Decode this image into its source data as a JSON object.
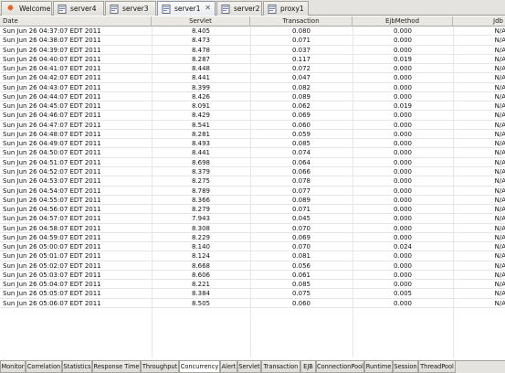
{
  "tabs": [
    {
      "label": "Welcome",
      "icon": "sun-icon",
      "active": false
    },
    {
      "label": "server4",
      "icon": "server-page-icon",
      "active": false
    },
    {
      "label": "server3",
      "icon": "server-page-icon",
      "active": false
    },
    {
      "label": "server1",
      "icon": "server-page-icon",
      "active": true,
      "close": "✕"
    },
    {
      "label": "server2",
      "icon": "server-page-icon",
      "active": false
    },
    {
      "label": "proxy1",
      "icon": "server-page-icon",
      "active": false
    }
  ],
  "table": {
    "headers": [
      "Date",
      "Servlet",
      "Transaction",
      "EjbMethod",
      "Jdb"
    ],
    "rows": [
      [
        "Sun Jun 26 04:37:07 EDT 2011",
        "8.405",
        "0.080",
        "0.000",
        "N/A"
      ],
      [
        "Sun Jun 26 04:38:07 EDT 2011",
        "8.473",
        "0.071",
        "0.000",
        "N/A"
      ],
      [
        "Sun Jun 26 04:39:07 EDT 2011",
        "8.478",
        "0.037",
        "0.000",
        "N/A"
      ],
      [
        "Sun Jun 26 04:40:07 EDT 2011",
        "8.287",
        "0.117",
        "0.019",
        "N/A"
      ],
      [
        "Sun Jun 26 04:41:07 EDT 2011",
        "8.448",
        "0.072",
        "0.000",
        "N/A"
      ],
      [
        "Sun Jun 26 04:42:07 EDT 2011",
        "8.441",
        "0.047",
        "0.000",
        "N/A"
      ],
      [
        "Sun Jun 26 04:43:07 EDT 2011",
        "8.399",
        "0.082",
        "0.000",
        "N/A"
      ],
      [
        "Sun Jun 26 04:44:07 EDT 2011",
        "8.426",
        "0.089",
        "0.000",
        "N/A"
      ],
      [
        "Sun Jun 26 04:45:07 EDT 2011",
        "8.091",
        "0.062",
        "0.019",
        "N/A"
      ],
      [
        "Sun Jun 26 04:46:07 EDT 2011",
        "8.429",
        "0.069",
        "0.000",
        "N/A"
      ],
      [
        "Sun Jun 26 04:47:07 EDT 2011",
        "8.541",
        "0.060",
        "0.000",
        "N/A"
      ],
      [
        "Sun Jun 26 04:48:07 EDT 2011",
        "8.281",
        "0.059",
        "0.000",
        "N/A"
      ],
      [
        "Sun Jun 26 04:49:07 EDT 2011",
        "8.493",
        "0.085",
        "0.000",
        "N/A"
      ],
      [
        "Sun Jun 26 04:50:07 EDT 2011",
        "8.441",
        "0.074",
        "0.000",
        "N/A"
      ],
      [
        "Sun Jun 26 04:51:07 EDT 2011",
        "8.698",
        "0.064",
        "0.000",
        "N/A"
      ],
      [
        "Sun Jun 26 04:52:07 EDT 2011",
        "8.379",
        "0.066",
        "0.000",
        "N/A"
      ],
      [
        "Sun Jun 26 04:53:07 EDT 2011",
        "8.275",
        "0.078",
        "0.000",
        "N/A"
      ],
      [
        "Sun Jun 26 04:54:07 EDT 2011",
        "8.789",
        "0.077",
        "0.000",
        "N/A"
      ],
      [
        "Sun Jun 26 04:55:07 EDT 2011",
        "8.366",
        "0.089",
        "0.000",
        "N/A"
      ],
      [
        "Sun Jun 26 04:56:07 EDT 2011",
        "8.279",
        "0.071",
        "0.000",
        "N/A"
      ],
      [
        "Sun Jun 26 04:57:07 EDT 2011",
        "7.943",
        "0.045",
        "0.000",
        "N/A"
      ],
      [
        "Sun Jun 26 04:58:07 EDT 2011",
        "8.308",
        "0.070",
        "0.000",
        "N/A"
      ],
      [
        "Sun Jun 26 04:59:07 EDT 2011",
        "8.229",
        "0.069",
        "0.000",
        "N/A"
      ],
      [
        "Sun Jun 26 05:00:07 EDT 2011",
        "8.140",
        "0.070",
        "0.024",
        "N/A"
      ],
      [
        "Sun Jun 26 05:01:07 EDT 2011",
        "8.124",
        "0.081",
        "0.000",
        "N/A"
      ],
      [
        "Sun Jun 26 05:02:07 EDT 2011",
        "8.668",
        "0.056",
        "0.000",
        "N/A"
      ],
      [
        "Sun Jun 26 05:03:07 EDT 2011",
        "8.606",
        "0.061",
        "0.000",
        "N/A"
      ],
      [
        "Sun Jun 26 05:04:07 EDT 2011",
        "8.221",
        "0.085",
        "0.000",
        "N/A"
      ],
      [
        "Sun Jun 26 05:05:07 EDT 2011",
        "8.384",
        "0.075",
        "0.005",
        "N/A"
      ],
      [
        "Sun Jun 26 05:06:07 EDT 2011",
        "8.505",
        "0.060",
        "0.000",
        "N/A"
      ]
    ]
  },
  "bottom_tabs": [
    {
      "label": "Monitor",
      "active": false
    },
    {
      "label": "Correlation",
      "active": false
    },
    {
      "label": "Statistics",
      "active": false
    },
    {
      "label": "Response Time",
      "active": false
    },
    {
      "label": "Throughput",
      "active": false
    },
    {
      "label": "Concurrency",
      "active": true
    },
    {
      "label": "Alert",
      "active": false
    },
    {
      "label": "Servlet",
      "active": false
    },
    {
      "label": "Transaction",
      "active": false
    },
    {
      "label": "EJB",
      "active": false
    },
    {
      "label": "ConnectionPool",
      "active": false
    },
    {
      "label": "Runtime",
      "active": false
    },
    {
      "label": "Session",
      "active": false
    },
    {
      "label": "ThreadPool",
      "active": false
    }
  ],
  "colors": {
    "welcome_icon": "#e2641e",
    "active_tab": "#e9ecf3"
  }
}
